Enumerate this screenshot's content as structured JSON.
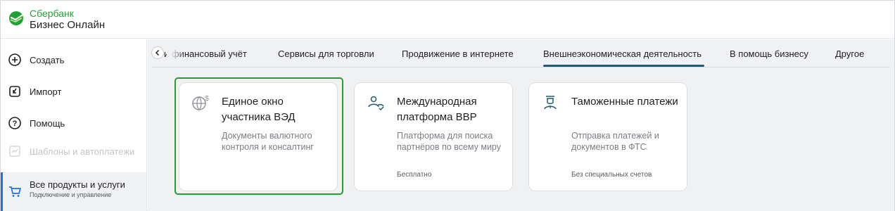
{
  "brand": {
    "line1": "Сбербанк",
    "line2": "Бизнес Онлайн",
    "color": "#21a038"
  },
  "sidebar": {
    "items": [
      {
        "label": "Создать",
        "icon": "plus-circle-icon"
      },
      {
        "label": "Импорт",
        "icon": "import-icon"
      },
      {
        "label": "Помощь",
        "icon": "help-circle-icon"
      },
      {
        "label": "Шаблоны и автоплатежи",
        "icon": "templates-icon",
        "disabled": true
      }
    ],
    "active": {
      "label": "Все продукты и услуги",
      "sub": "Подключение и управление",
      "icon": "cart-icon"
    }
  },
  "tabs": {
    "back_icon": "chevron-left-icon",
    "items": [
      {
        "label": "и финансовый учёт"
      },
      {
        "label": "Сервисы для торговли"
      },
      {
        "label": "Продвижение в интернете"
      },
      {
        "label": "Внешнеэкономическая деятельность",
        "active": true
      },
      {
        "label": "В помощь бизнесу"
      },
      {
        "label": "Другое"
      }
    ]
  },
  "cards": [
    {
      "title": "Единое окно участника ВЭД",
      "desc": "Документы валютного контроля и консалтинг",
      "note": "",
      "icon": "globe-dollar-icon",
      "selected": true
    },
    {
      "title": "Международная платформа ВВР",
      "desc": "Платформа для поиска партнёров по всему миру",
      "note": "Бесплатно",
      "icon": "people-icon"
    },
    {
      "title": "Таможенные платежи",
      "desc": "Отправка платежей и документов в ФТС",
      "note": "Без специальных счетов",
      "icon": "customs-icon"
    }
  ],
  "colors": {
    "accent_green": "#21a038",
    "tab_underline": "#1f5a73",
    "active_marker": "#1f6fe5"
  }
}
